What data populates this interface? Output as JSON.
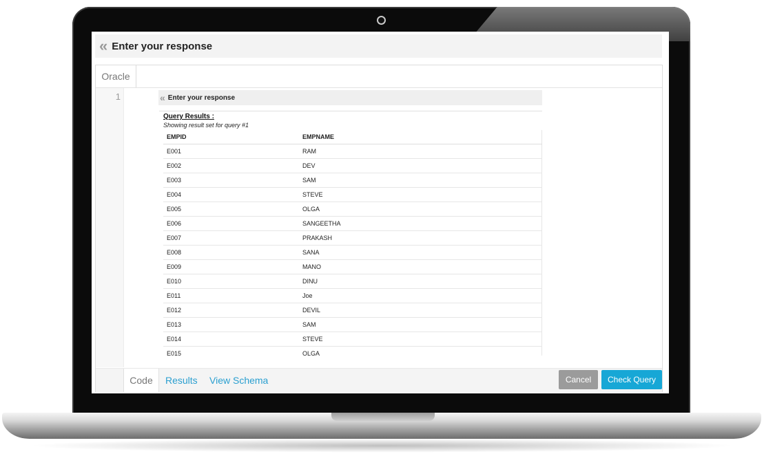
{
  "header": {
    "title": "Enter your response"
  },
  "editor": {
    "language_tab": "Oracle",
    "line_number": "1"
  },
  "embedded_panel": {
    "title": "Enter your response",
    "query_results_title": "Query Results :",
    "query_results_subtitle": "Showing result set for query #1",
    "columns": [
      "EMPID",
      "EMPNAME"
    ],
    "rows": [
      [
        "E001",
        "RAM"
      ],
      [
        "E002",
        "DEV"
      ],
      [
        "E003",
        "SAM"
      ],
      [
        "E004",
        "STEVE"
      ],
      [
        "E005",
        "OLGA"
      ],
      [
        "E006",
        "SANGEETHA"
      ],
      [
        "E007",
        "PRAKASH"
      ],
      [
        "E008",
        "SANA"
      ],
      [
        "E009",
        "MANO"
      ],
      [
        "E010",
        "DINU"
      ],
      [
        "E011",
        "Joe"
      ],
      [
        "E012",
        "DEVIL"
      ],
      [
        "E013",
        "SAM"
      ],
      [
        "E014",
        "STEVE"
      ],
      [
        "E015",
        "OLGA"
      ]
    ]
  },
  "bottom_tabs": {
    "code": "Code",
    "results": "Results",
    "view_schema": "View Schema"
  },
  "buttons": {
    "cancel": "Cancel",
    "check_query": "Check Query"
  },
  "icons": {
    "collapse": "double-chevron-left-icon",
    "camera": "camera-icon"
  },
  "colors": {
    "link": "#2a9fd0",
    "primary_button": "#17a7d6",
    "cancel_button": "#9b9b9b"
  }
}
